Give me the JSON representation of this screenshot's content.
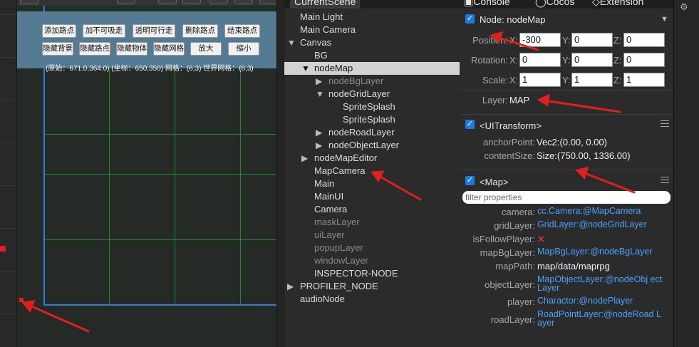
{
  "game": {
    "buttons_row1": [
      "添加路点",
      "加不可吸走",
      "透明可行走",
      "删除路点",
      "结束路点"
    ],
    "buttons_row2": [
      "隐藏背景",
      "隐藏路点",
      "隐藏物体",
      "隐藏网格",
      "放大",
      "缩小"
    ],
    "coords": "(原始：671.0,364.0) (坐标：650,350) 网格：(6,3) 世界网格：(6,3)"
  },
  "hierarchy": {
    "tab_label": "CurrentScene",
    "rows": [
      {
        "label": "Main Light",
        "indent": 0,
        "arrow": "",
        "state": "normal"
      },
      {
        "label": "Main Camera",
        "indent": 0,
        "arrow": "",
        "state": "normal"
      },
      {
        "label": "Canvas",
        "indent": 0,
        "arrow": "▼",
        "state": "normal"
      },
      {
        "label": "BG",
        "indent": 1,
        "arrow": "",
        "state": "normal"
      },
      {
        "label": "nodeMap",
        "indent": 1,
        "arrow": "▼",
        "state": "selected"
      },
      {
        "label": "nodeBgLayer",
        "indent": 2,
        "arrow": "▶",
        "state": "dim"
      },
      {
        "label": "nodeGridLayer",
        "indent": 2,
        "arrow": "▼",
        "state": "normal"
      },
      {
        "label": "SpriteSplash",
        "indent": 3,
        "arrow": "",
        "state": "normal"
      },
      {
        "label": "SpriteSplash",
        "indent": 3,
        "arrow": "",
        "state": "normal"
      },
      {
        "label": "nodeRoadLayer",
        "indent": 2,
        "arrow": "▶",
        "state": "normal"
      },
      {
        "label": "nodeObjectLayer",
        "indent": 2,
        "arrow": "▶",
        "state": "normal"
      },
      {
        "label": "nodeMapEditor",
        "indent": 1,
        "arrow": "▶",
        "state": "normal"
      },
      {
        "label": "MapCamera",
        "indent": 1,
        "arrow": "",
        "state": "normal"
      },
      {
        "label": "Main",
        "indent": 1,
        "arrow": "",
        "state": "normal"
      },
      {
        "label": "MainUI",
        "indent": 1,
        "arrow": "",
        "state": "normal"
      },
      {
        "label": "Camera",
        "indent": 1,
        "arrow": "",
        "state": "normal"
      },
      {
        "label": "maskLayer",
        "indent": 1,
        "arrow": "",
        "state": "dim"
      },
      {
        "label": "uiLayer",
        "indent": 1,
        "arrow": "",
        "state": "dim"
      },
      {
        "label": "popupLayer",
        "indent": 1,
        "arrow": "",
        "state": "dim"
      },
      {
        "label": "windowLayer",
        "indent": 1,
        "arrow": "",
        "state": "dim"
      },
      {
        "label": "INSPECTOR-NODE",
        "indent": 1,
        "arrow": "",
        "state": "normal"
      },
      {
        "label": "PROFILER_NODE",
        "indent": 0,
        "arrow": "▶",
        "state": "normal"
      },
      {
        "label": "audioNode",
        "indent": 0,
        "arrow": "",
        "state": "normal"
      }
    ]
  },
  "inspector_tabs": [
    "Console",
    "Cocos",
    "Extension"
  ],
  "inspector": {
    "node_title": "Node: nodeMap",
    "position_label": "Position:",
    "rotation_label": "Rotation:",
    "scale_label": "Scale:",
    "axis_x": "X:",
    "axis_y": "Y:",
    "axis_z": "Z:",
    "position": [
      "-300",
      "0",
      "0"
    ],
    "rotation": [
      "0",
      "0",
      "0"
    ],
    "scale": [
      "1",
      "1",
      "1"
    ],
    "layer_label": "Layer:",
    "layer_value": "MAP",
    "uitransform_title": "<UITransform>",
    "anchor_label": "anchorPoint:",
    "anchor_value": "Vec2:(0.00, 0.00)",
    "content_label": "contentSize:",
    "content_value": "Size:(750.00, 1336.00)",
    "map_title": "<Map>",
    "filter_placeholder": "filter properties",
    "map_props": [
      {
        "label": "camera:",
        "value": "cc.Camera:@MapCamera",
        "kind": "link"
      },
      {
        "label": "gridLayer:",
        "value": "GridLayer:@nodeGridLayer",
        "kind": "link"
      },
      {
        "label": "isFollowPlayer:",
        "value": "✕",
        "kind": "cross"
      },
      {
        "label": "mapBgLayer:",
        "value": "MapBgLayer:@nodeBgLayer",
        "kind": "link"
      },
      {
        "label": "mapPath:",
        "value": "map/data/maprpg",
        "kind": "plain"
      },
      {
        "label": "objectLayer:",
        "value": "MapObjectLayer:@nodeObj ectLayer",
        "kind": "link2"
      },
      {
        "label": "player:",
        "value": "Charactor:@nodePlayer",
        "kind": "link"
      },
      {
        "label": "roadLayer:",
        "value": "RoadPointLayer:@nodeRoad Layer",
        "kind": "link2"
      }
    ]
  },
  "colors": {
    "accent": "#1f7ae0",
    "link": "#4aa1ff",
    "annotation": "#e02020"
  }
}
